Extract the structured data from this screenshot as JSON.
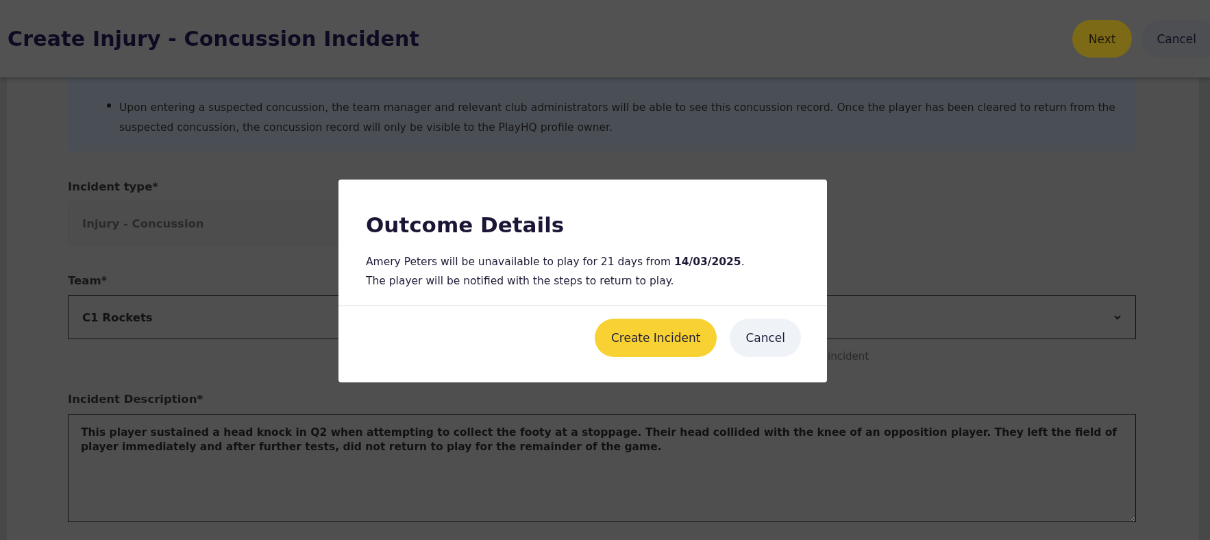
{
  "header": {
    "title": "Create Injury - Concussion Incident",
    "buttons": [
      {
        "label": "Next",
        "kind": "primary"
      },
      {
        "label": "Cancel",
        "kind": "secondary"
      }
    ]
  },
  "notice": {
    "bullets": [
      "Upon entering a suspected concussion, the team manager and relevant club administrators will be able to see this concussion record. Once the player has been cleared to return from the suspected concussion, the concussion record will only be visible to the PlayHQ profile owner."
    ]
  },
  "form": {
    "fields": [
      {
        "kind": "text",
        "label": "Incident type*",
        "value": "Injury - Concussion",
        "disabled": true
      },
      {
        "kind": "select",
        "label": "Team*",
        "value": "C1 Rockets",
        "disabled": false,
        "hint": "incident"
      },
      {
        "kind": "textarea",
        "label": "Incident Description*",
        "value": "This player sustained a head knock in Q2 when attempting to collect the footy at a stoppage. Their head collided with the knee of an opposition player. They left the field of player immediately and after further tests, did not return to play for the remainder of the game.",
        "disabled": false
      }
    ]
  },
  "dialog": {
    "title": "Outcome Details",
    "lines": [
      "Amery Peters will be unavailable to play for 21 days from **14/03/2025**.",
      "The player will be notified with the steps to return to play."
    ],
    "buttons": [
      {
        "label": "Create Incident",
        "kind": "primary"
      },
      {
        "label": "Cancel",
        "kind": "secondary"
      }
    ]
  }
}
